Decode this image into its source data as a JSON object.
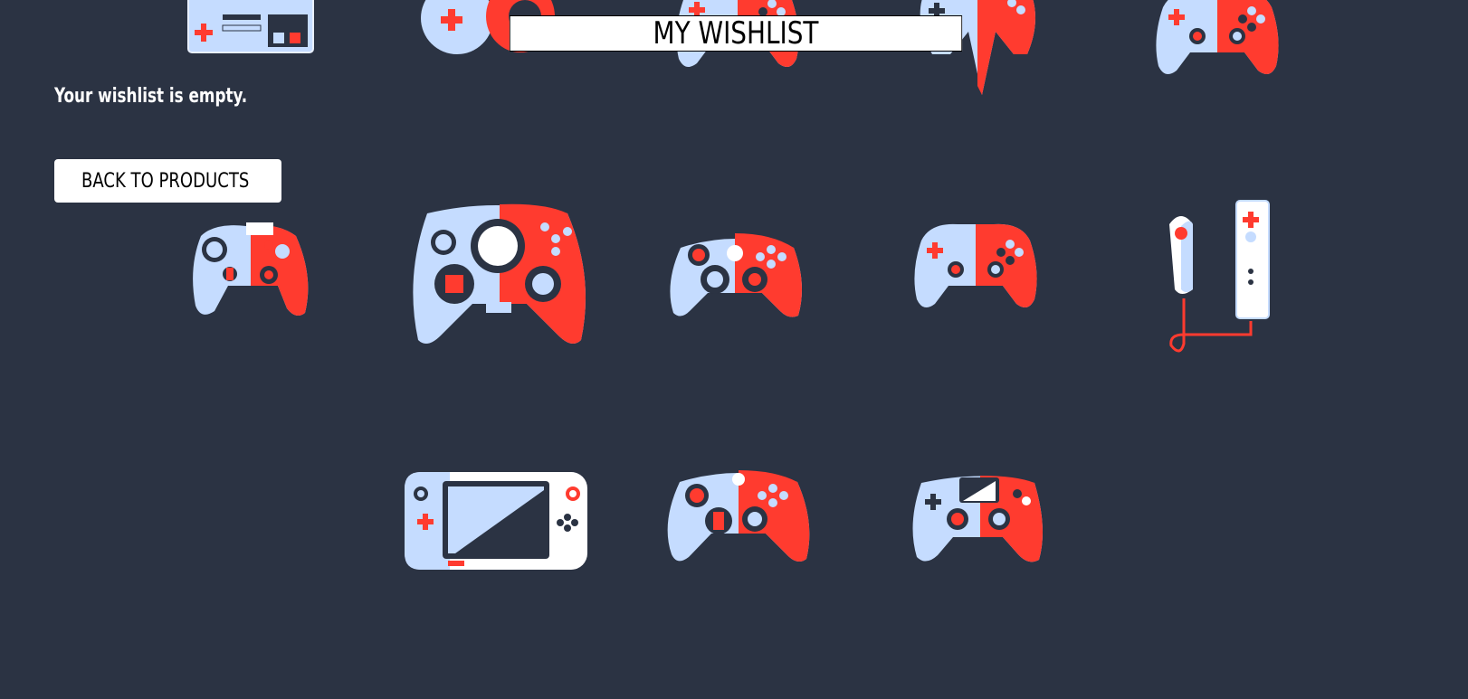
{
  "header": {
    "title": "MY WISHLIST"
  },
  "wishlist": {
    "empty_message": "Your wishlist is empty."
  },
  "actions": {
    "back_label": "BACK TO PRODUCTS"
  },
  "colors": {
    "background": "#2b3343",
    "accent_red": "#ff3b2f",
    "accent_blue": "#c5dcff",
    "dark": "#2b3343"
  },
  "background_icons": [
    "nes-controller-icon",
    "snes-controller-icon",
    "playstation-controller-icon",
    "n64-controller-icon",
    "ps-dualshock-controller-icon",
    "gamecube-controller-icon",
    "dreamcast-controller-icon",
    "xbox360-controller-icon",
    "ps3-controller-icon",
    "wii-remote-icon",
    "wiiu-gamepad-icon",
    "xbox-one-controller-icon",
    "ps4-controller-icon"
  ]
}
